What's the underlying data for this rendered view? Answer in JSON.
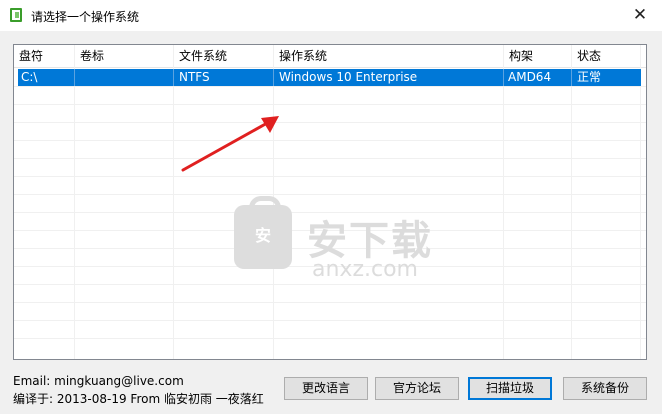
{
  "window": {
    "title": "请选择一个操作系统",
    "close_glyph": "✕"
  },
  "table": {
    "columns": [
      "盘符",
      "卷标",
      "文件系统",
      "操作系统",
      "构架",
      "状态"
    ],
    "rows": [
      {
        "drive": "C:\\",
        "label": "",
        "fs": "NTFS",
        "os": "Windows 10 Enterprise",
        "arch": "AMD64",
        "status": "正常"
      }
    ]
  },
  "watermark": {
    "title": "安下载",
    "subtitle": "anxz.com",
    "badge": "安"
  },
  "footer": {
    "email": "Email:  mingkuang@live.com",
    "compile": "编译于: 2013-08-19 From 临安初雨 一夜落红"
  },
  "buttons": {
    "change_language": "更改语言",
    "forum": "官方论坛",
    "scan": "扫描垃圾",
    "backup": "系统备份"
  },
  "colors": {
    "selection": "#0078d7",
    "arrow": "#e02020"
  }
}
